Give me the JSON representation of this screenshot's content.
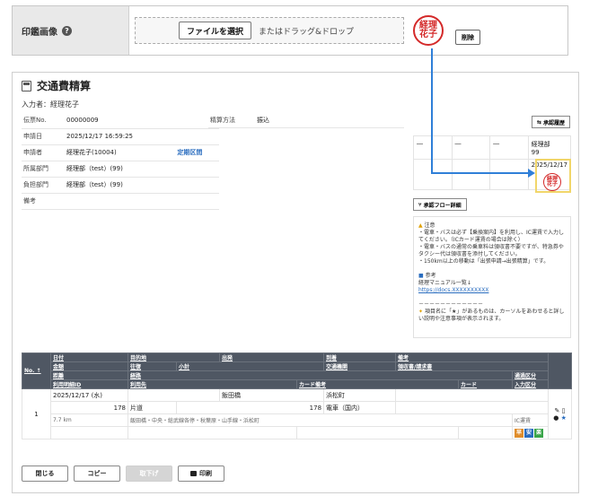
{
  "seal": {
    "label": "印鑑画像",
    "help": "?",
    "file_button": "ファイルを選択",
    "drop_hint": "またはドラッグ&ドロップ",
    "stamp_line1": "経理",
    "stamp_line2": "花子",
    "delete_button": "削除"
  },
  "page": {
    "title": "交通費精算",
    "author": "入力者：経理花子"
  },
  "info": {
    "rows": [
      {
        "key": "伝票No.",
        "value": "00000009"
      },
      {
        "key": "申請日",
        "value": "2025/12/17 16:59:25"
      },
      {
        "key": "申請者",
        "value": "経理花子(10004)",
        "link": "定期区間"
      },
      {
        "key": "所属部門",
        "value": "経理部（test）(99)"
      },
      {
        "key": "負担部門",
        "value": "経理部（test）(99)"
      },
      {
        "key": "備考",
        "value": ""
      }
    ],
    "method_key": "精算方法",
    "method_value": "振込"
  },
  "approval": {
    "history_button": "承認履歴",
    "cols": [
      "―",
      "―",
      "―"
    ],
    "last_top": "経理部",
    "last_top2": "99",
    "approved_date": "2025/12/17",
    "approved_seal1": "経理",
    "approved_seal2": "花子",
    "flow_button": "承認フロー詳細"
  },
  "notes": {
    "warn_title": "注意",
    "line1": "・電車・バスは必ず【乗換案内】を利用し、IC運賃で入力してください。（ICカード運賃の場合は除く）",
    "line2": "・電車・バスの通常の乗車料は領収書不要ですが、特急券やタクシー代は領収書を添付してください。",
    "line3": "・150km以上の移動は「出張申請→出張精算」です。",
    "ref_title": "参考",
    "ref_line": "経理マニュアル一覧↓",
    "ref_url": "https://docs.XXXXXXXXXX",
    "separator": "－－－－－－－－－－－－",
    "tip": "項目名に「★」があるものは、カーソルをあわせると詳しい説明や注意事項が表示されます。"
  },
  "detail": {
    "no_header": "No. ↑",
    "h1": [
      "日付",
      "目的地",
      "出発",
      "到着",
      "備考"
    ],
    "h2": [
      "金額",
      "往復",
      "小計",
      "交通機関",
      "領収書/請求書"
    ],
    "h3": [
      "距離",
      "経路",
      "通過区分"
    ],
    "h4": [
      "利用明細ID",
      "利用先",
      "カード備考",
      "カード",
      "入力区分"
    ],
    "row": {
      "no": "1",
      "date": "2025/12/17 (水)",
      "from": "飯田橋",
      "to": "浜松町",
      "amount": "178",
      "roundtrip": "片道",
      "subtotal": "178",
      "transport": "電車（国内）",
      "distance": "7.7 km",
      "route": "飯田橋・中央・総武線各停・秋葉原・山手線・浜松町",
      "pass_type": "IC運賃",
      "badge1": "早",
      "badge2": "安",
      "badge3": "楽"
    }
  },
  "footer": {
    "close": "閉じる",
    "copy": "コピー",
    "withdraw": "取下げ",
    "print": "印刷"
  }
}
